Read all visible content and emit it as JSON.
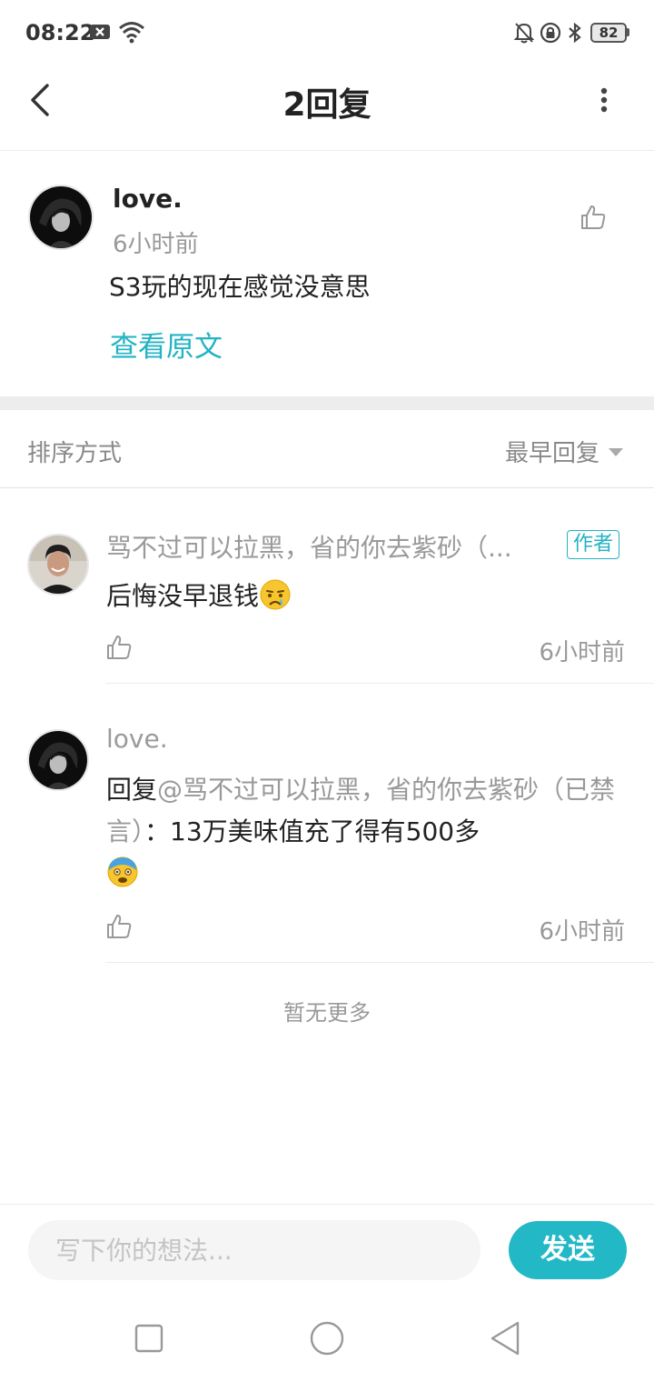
{
  "status_bar": {
    "time": "08:22",
    "battery": "82",
    "icons": [
      "notification-x-icon",
      "wifi-icon",
      "mute-bell-icon",
      "lock-rotation-icon",
      "bluetooth-icon",
      "battery-icon"
    ]
  },
  "header": {
    "title": "2回复",
    "back_icon": "back-arrow-icon",
    "more_icon": "more-vertical-icon"
  },
  "original": {
    "username": "love.",
    "time": "6小时前",
    "text": "S3玩的现在感觉没意思",
    "view_original": "查看原文",
    "like_icon": "thumbs-up-icon"
  },
  "sort": {
    "label": "排序方式",
    "selected": "最早回复"
  },
  "replies": [
    {
      "username": "骂不过可以拉黑，省的你去紫砂（...",
      "badge": "作者",
      "text": "后悔没早退钱",
      "emoji": "crying-face-emoji",
      "time": "6小时前"
    },
    {
      "username": "love.",
      "reply_prefix": "回复",
      "mention": "@骂不过可以拉黑，省的你去紫砂（已禁言）",
      "text": "：13万美味值充了得有500多",
      "emoji": "anxious-face-emoji",
      "time": "6小时前"
    }
  ],
  "no_more": "暂无更多",
  "input": {
    "placeholder": "写下你的想法...",
    "send_label": "发送"
  },
  "colors": {
    "accent": "#22b8c6",
    "muted_text": "#999999",
    "divider": "#ededed"
  }
}
